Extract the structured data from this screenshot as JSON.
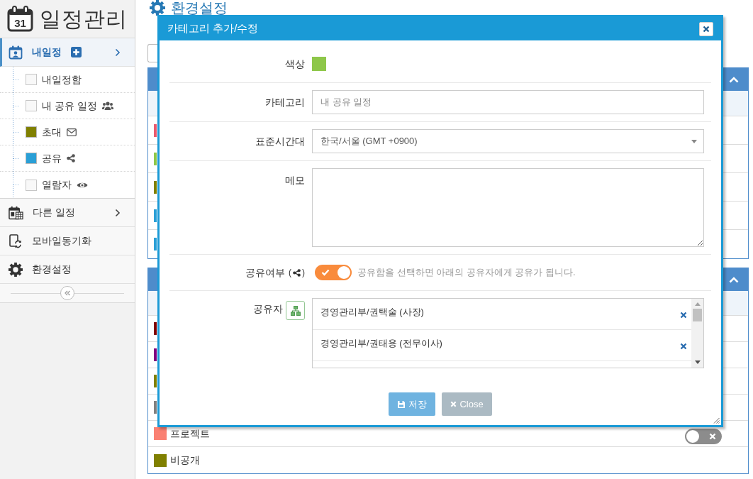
{
  "sidebar": {
    "logo": {
      "icon_text": "31",
      "title": "일정관리"
    },
    "menu": [
      {
        "label": "내일정",
        "selected": true,
        "add_button": true,
        "submenu": true,
        "children": [
          {
            "label": "내일정함",
            "checked": false
          },
          {
            "label": "내 공유 일정",
            "checked": false
          },
          {
            "label": "초대",
            "checked": true,
            "color": "#808000"
          },
          {
            "label": "공유",
            "checked": true,
            "color": "#2a9fd6"
          },
          {
            "label": "열람자",
            "checked": false
          }
        ]
      },
      {
        "label": "다른 일정",
        "selected": false,
        "add_button": false,
        "submenu": true
      },
      {
        "label": "모바일동기화",
        "selected": false,
        "add_button": false,
        "submenu": false
      },
      {
        "label": "환경설정",
        "selected": false,
        "add_button": false,
        "submenu": false
      }
    ]
  },
  "page_title": "환경설정",
  "panels": [
    {
      "expanded": true,
      "rows": [
        {
          "color": "#e95a6e"
        },
        {
          "color": "#8ec74a"
        },
        {
          "color": "#808000"
        },
        {
          "color": "#2a9fd6"
        },
        {
          "color": "#2a9fd6"
        }
      ]
    },
    {
      "expanded": true,
      "rows": [
        {
          "color": "#800000"
        },
        {
          "color": "#800080"
        },
        {
          "color": "#808000"
        },
        {
          "color": "#808080"
        },
        {
          "color": "#fa8072",
          "label": "프로젝트",
          "on": false
        },
        {
          "color": "#808000",
          "label": "비공개"
        }
      ]
    }
  ],
  "dialog": {
    "title": "카테고리 추가/수정",
    "fields": [
      {
        "kind": "color",
        "label": "색상",
        "color": "#8ec74a"
      },
      {
        "kind": "text",
        "label": "카테고리",
        "value": "내 공유 일정"
      },
      {
        "kind": "select",
        "label": "표준시간대",
        "value": "한국/서울 (GMT +0900)"
      },
      {
        "kind": "textarea",
        "label": "메모"
      },
      {
        "kind": "switch",
        "label": "공유여부",
        "paren_open": "(",
        "paren_close": ")",
        "on": true,
        "help": "공유함을 선택하면 아래의 공유자에게 공유가 됩니다."
      },
      {
        "kind": "list",
        "label": "공유자",
        "items": [
          "경영관리부/권택술 (사장)",
          "경영관리부/권태용 (전무이사)"
        ]
      }
    ],
    "buttons": [
      {
        "label": "저장",
        "kind": "save"
      },
      {
        "label": "Close",
        "kind": "close"
      }
    ]
  }
}
